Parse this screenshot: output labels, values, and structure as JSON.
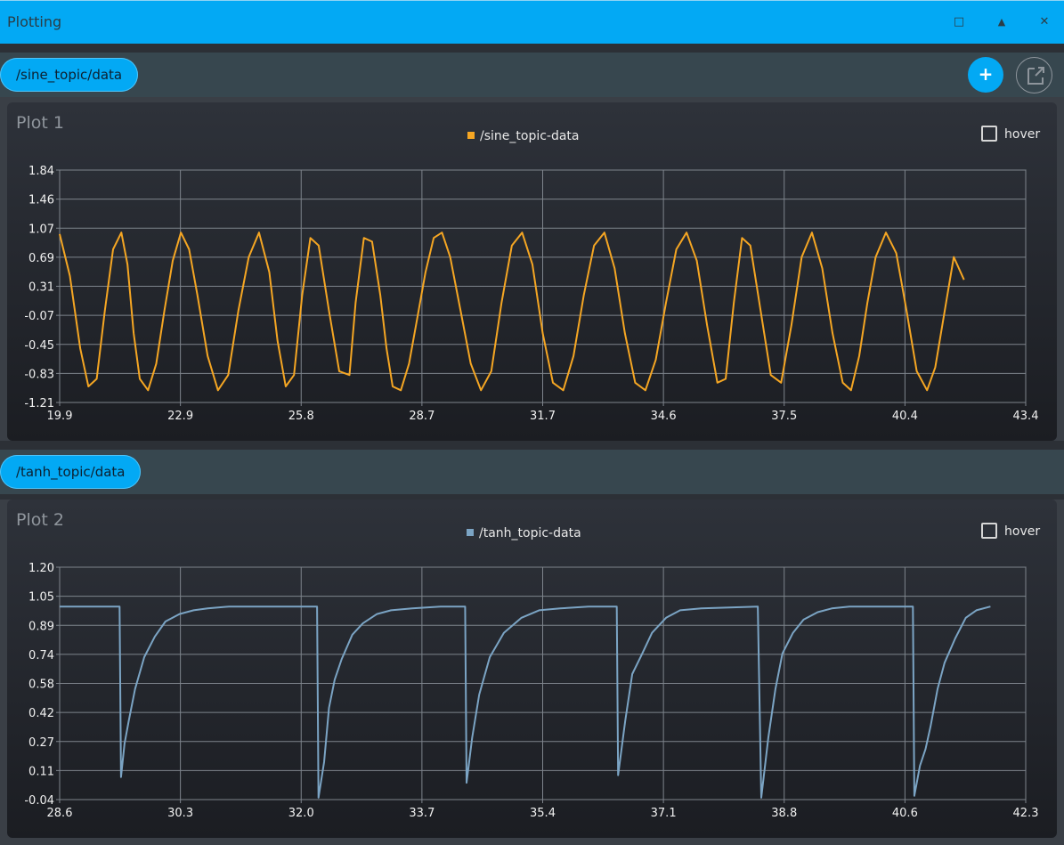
{
  "window": {
    "title": "Plotting",
    "maximize_glyph": "□",
    "up_glyph": "▲",
    "close_glyph": "✕"
  },
  "toolbar": {
    "add_glyph": "+"
  },
  "plots": [
    {
      "topic_chip": "/sine_topic/data",
      "title": "Plot 1",
      "legend": "/sine_topic-data",
      "hover_label": "hover",
      "color": "#f5a623"
    },
    {
      "topic_chip": "/tanh_topic/data",
      "title": "Plot 2",
      "legend": "/tanh_topic-data",
      "hover_label": "hover",
      "color": "#7ba4c4"
    }
  ],
  "chart_data": [
    {
      "type": "line",
      "title": "Plot 1",
      "series": [
        {
          "name": "/sine_topic-data",
          "color": "#f5a623",
          "x": [
            19.9,
            20.15,
            20.4,
            20.6,
            20.8,
            21.0,
            21.2,
            21.4,
            21.55,
            21.7,
            21.85,
            22.05,
            22.25,
            22.45,
            22.65,
            22.85,
            23.05,
            23.25,
            23.5,
            23.75,
            24.0,
            24.25,
            24.5,
            24.75,
            25.0,
            25.2,
            25.4,
            25.6,
            25.8,
            26.0,
            26.2,
            26.45,
            26.7,
            26.95,
            27.1,
            27.3,
            27.5,
            27.7,
            27.85,
            28.0,
            28.2,
            28.4,
            28.6,
            28.8,
            29.0,
            29.2,
            29.4,
            29.65,
            29.9,
            30.15,
            30.4,
            30.65,
            30.9,
            31.15,
            31.4,
            31.65,
            31.9,
            32.15,
            32.4,
            32.65,
            32.9,
            33.15,
            33.4,
            33.65,
            33.9,
            34.15,
            34.4,
            34.65,
            34.9,
            35.15,
            35.4,
            35.65,
            35.9,
            36.1,
            36.3,
            36.5,
            36.7,
            36.95,
            37.2,
            37.45,
            37.7,
            37.95,
            38.2,
            38.45,
            38.7,
            38.95,
            39.15,
            39.35,
            39.55,
            39.75,
            40.0,
            40.25,
            40.5,
            40.75,
            41.0,
            41.2,
            41.4,
            41.65,
            41.9
          ],
          "y": [
            1.0,
            0.45,
            -0.5,
            -1.0,
            -0.9,
            0.0,
            0.8,
            1.02,
            0.6,
            -0.3,
            -0.9,
            -1.05,
            -0.7,
            0.0,
            0.65,
            1.02,
            0.8,
            0.2,
            -0.6,
            -1.05,
            -0.85,
            0.0,
            0.7,
            1.02,
            0.5,
            -0.4,
            -1.0,
            -0.85,
            0.2,
            0.95,
            0.85,
            0.0,
            -0.8,
            -0.85,
            0.1,
            0.95,
            0.9,
            0.2,
            -0.5,
            -1.0,
            -1.05,
            -0.7,
            -0.1,
            0.5,
            0.95,
            1.02,
            0.7,
            0.0,
            -0.7,
            -1.05,
            -0.8,
            0.1,
            0.85,
            1.02,
            0.6,
            -0.3,
            -0.95,
            -1.05,
            -0.6,
            0.2,
            0.85,
            1.02,
            0.55,
            -0.3,
            -0.95,
            -1.05,
            -0.65,
            0.1,
            0.8,
            1.02,
            0.65,
            -0.2,
            -0.95,
            -0.9,
            0.1,
            0.95,
            0.85,
            0.0,
            -0.85,
            -0.95,
            -0.2,
            0.7,
            1.02,
            0.55,
            -0.3,
            -0.95,
            -1.05,
            -0.6,
            0.1,
            0.7,
            1.02,
            0.75,
            0.0,
            -0.8,
            -1.05,
            -0.75,
            -0.1,
            0.7,
            0.4
          ]
        }
      ],
      "xlim": [
        19.9,
        43.4
      ],
      "ylim": [
        -1.21,
        1.84
      ],
      "xticks": [
        "19.9",
        "22.9",
        "25.8",
        "28.7",
        "31.7",
        "34.6",
        "37.5",
        "40.4",
        "43.4"
      ],
      "yticks": [
        "1.84",
        "1.46",
        "1.07",
        "0.69",
        "0.31",
        "-0.07",
        "-0.45",
        "-0.83",
        "-1.21"
      ],
      "grid": true,
      "legend_position": "top-center"
    },
    {
      "type": "line",
      "title": "Plot 2",
      "series": [
        {
          "name": "/tanh_topic-data",
          "color": "#7ba4c4",
          "x": [
            28.6,
            29.45,
            29.47,
            29.52,
            29.58,
            29.67,
            29.8,
            29.95,
            30.1,
            30.3,
            30.5,
            30.7,
            31.0,
            31.4,
            32.0,
            32.25,
            32.27,
            32.35,
            32.42,
            32.5,
            32.6,
            32.75,
            32.9,
            33.1,
            33.3,
            33.6,
            34.0,
            34.35,
            34.37,
            34.45,
            34.55,
            34.7,
            34.9,
            35.15,
            35.4,
            35.7,
            36.1,
            36.5,
            36.52,
            36.62,
            36.72,
            36.85,
            37.0,
            37.2,
            37.4,
            37.7,
            38.5,
            38.55,
            38.65,
            38.75,
            38.85,
            39.0,
            39.15,
            39.35,
            39.55,
            39.8,
            40.1,
            40.5,
            40.7,
            40.72,
            40.8,
            40.88,
            40.95,
            41.05,
            41.15,
            41.3,
            41.45,
            41.6,
            41.8
          ],
          "y": [
            0.99,
            0.99,
            0.08,
            0.26,
            0.38,
            0.55,
            0.72,
            0.83,
            0.91,
            0.95,
            0.97,
            0.98,
            0.99,
            0.99,
            0.99,
            0.99,
            -0.03,
            0.16,
            0.45,
            0.6,
            0.71,
            0.84,
            0.9,
            0.95,
            0.97,
            0.98,
            0.99,
            0.99,
            0.05,
            0.29,
            0.52,
            0.72,
            0.85,
            0.93,
            0.97,
            0.98,
            0.99,
            0.99,
            0.09,
            0.38,
            0.63,
            0.73,
            0.85,
            0.93,
            0.97,
            0.98,
            0.99,
            -0.03,
            0.29,
            0.55,
            0.74,
            0.85,
            0.92,
            0.96,
            0.98,
            0.99,
            0.99,
            0.99,
            0.99,
            -0.02,
            0.14,
            0.23,
            0.35,
            0.55,
            0.69,
            0.82,
            0.93,
            0.97,
            0.99
          ]
        }
      ],
      "xlim": [
        28.6,
        42.3
      ],
      "ylim": [
        -0.04,
        1.2
      ],
      "xticks": [
        "28.6",
        "30.3",
        "32.0",
        "33.7",
        "35.4",
        "37.1",
        "38.8",
        "40.6",
        "42.3"
      ],
      "yticks": [
        "1.20",
        "1.05",
        "0.89",
        "0.74",
        "0.58",
        "0.42",
        "0.27",
        "0.11",
        "-0.04"
      ],
      "grid": true,
      "legend_position": "top-center"
    }
  ]
}
